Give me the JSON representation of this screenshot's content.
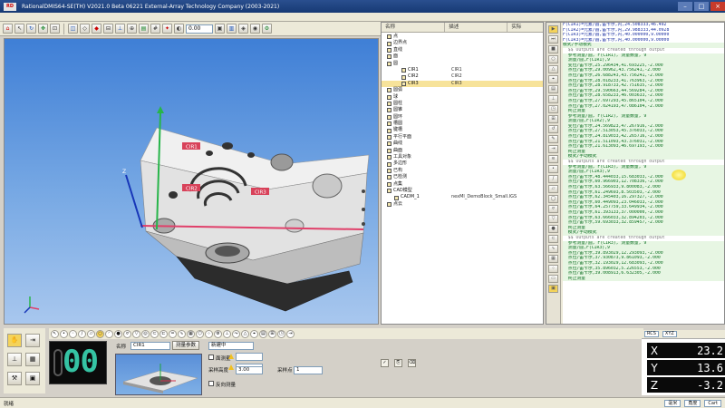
{
  "window": {
    "title": "RationalDMIS64-SE(TH) V2021.0 Beta 06221    External-Array Technology Company (2003-2021)",
    "app_badge": "RD",
    "minimize": "–",
    "maximize": "□",
    "close": "×"
  },
  "toolbar": {
    "zoom_value": "0.00"
  },
  "viewport": {
    "feature_labels": [
      "CIR1",
      "CIR2",
      "CIR3"
    ],
    "axis_label_z": "Z",
    "colors": {
      "sky_top": "#3f7fd6",
      "part": "#e4e4e4",
      "label_bg": "#d8425a",
      "axis_x": "#e0406a",
      "axis_y": "#27b54a",
      "axis_z": "#1736b8"
    }
  },
  "tree": {
    "columns": [
      "名称",
      "描述",
      "实际"
    ],
    "rows": [
      {
        "name": "点",
        "value": ""
      },
      {
        "name": "边界点",
        "value": ""
      },
      {
        "name": "直线",
        "value": ""
      },
      {
        "name": "面",
        "value": ""
      },
      {
        "name": "圆",
        "value": ""
      },
      {
        "name": "CIR1",
        "value": "CIR1",
        "indent": 2
      },
      {
        "name": "CIR2",
        "value": "CIR2",
        "indent": 2
      },
      {
        "name": "CIR3",
        "value": "CIR3",
        "indent": 2,
        "selected": true
      },
      {
        "name": "圆弧",
        "value": ""
      },
      {
        "name": "球",
        "value": ""
      },
      {
        "name": "圆柱",
        "value": ""
      },
      {
        "name": "圆锥",
        "value": ""
      },
      {
        "name": "圆环",
        "value": ""
      },
      {
        "name": "槽圆",
        "value": ""
      },
      {
        "name": "键槽",
        "value": ""
      },
      {
        "name": "平行平面",
        "value": ""
      },
      {
        "name": "曲线",
        "value": ""
      },
      {
        "name": "曲面",
        "value": ""
      },
      {
        "name": "工具对象",
        "value": ""
      },
      {
        "name": "多边形",
        "value": ""
      },
      {
        "name": "已构",
        "value": ""
      },
      {
        "name": "已检测",
        "value": ""
      },
      {
        "name": "点集",
        "value": ""
      },
      {
        "name": "CAD模型",
        "value": ""
      },
      {
        "name": "CADM_1",
        "value": "nexMl_DemoBlock_Small.IGS",
        "indent": 1
      },
      {
        "name": "点云",
        "value": ""
      }
    ]
  },
  "editor": {
    "lines": [
      {
        "t": "F(CIR1)=元素/圆,笛卡尔,内,24.508333,46.492",
        "c": "blue"
      },
      {
        "t": "F(CIR2)=元素/圆,笛卡尔,内,29.988333,44.0928",
        "c": "blue"
      },
      {
        "t": "F(CIR3)=元素/圆,笛卡尔,内,40.000000,9.00000",
        "c": "blue"
      },
      {
        "t": "F(CIR3)=元素/圆,笛卡尔,内,40.000000,9.00000",
        "c": "blue"
      },
      {
        "t": "模式/手动模式",
        "c": "green"
      },
      {
        "t": "  $$ Outputs are created through output",
        "c": "grey"
      },
      {
        "t": "  参考测量/圆, F(CIR1), 测量数量, 9",
        "c": "green"
      },
      {
        "t": "  测量/圆,F(CIR1),9",
        "c": "green"
      },
      {
        "t": "  变位/笛卡尔,25.296434,41.693225,-2.000",
        "c": "green"
      },
      {
        "t": "  点位/笛卡尔,29.00962,43.756241,-2.000",
        "c": "green"
      },
      {
        "t": "  点位/笛卡尔,26.688243,43.756241,-2.000",
        "c": "green"
      },
      {
        "t": "  点位/笛卡尔,28.018233,41.763963,-2.000",
        "c": "green"
      },
      {
        "t": "  点位/笛卡尔,28.918733,42.751635,-2.000",
        "c": "green"
      },
      {
        "t": "  点位/笛卡尔,29.590663,44.569284,-2.000",
        "c": "green"
      },
      {
        "t": "  点位/笛卡尔,28.658233,46.003633,-2.000",
        "c": "green"
      },
      {
        "t": "  点位/笛卡尔,27.697293,45.865104,-2.000",
        "c": "green"
      },
      {
        "t": "  点位/笛卡尔,27.024193,47.086104,-2.000",
        "c": "green"
      },
      {
        "t": "  终止测量",
        "c": "green"
      },
      {
        "t": "  参考测量/圆, F(CIR2), 测量数量, 9",
        "c": "green"
      },
      {
        "t": "  测量/圆,F(CIR2),9",
        "c": "green"
      },
      {
        "t": "  变位/笛卡尔,24.569823,47.267916,-2.000",
        "c": "green"
      },
      {
        "t": "  点位/笛卡尔,27.513053,45.376033,-2.000",
        "c": "green"
      },
      {
        "t": "  点位/笛卡尔,24.819033,42.265716,-2.000",
        "c": "green"
      },
      {
        "t": "  点位/笛卡尔,21.511093,43.376031,-2.000",
        "c": "green"
      },
      {
        "t": "  点位/笛卡尔,21.613093,46.697193,-2.000",
        "c": "green"
      },
      {
        "t": "  终止测量",
        "c": "green"
      },
      {
        "t": "  模式/手动模式",
        "c": "green"
      },
      {
        "t": "  $$ Outputs are created through output",
        "c": "grey"
      },
      {
        "t": "  参考测量/圆, F(CIR3), 测量数量, 9",
        "c": "green"
      },
      {
        "t": "  测量/圆,F(CIR3),9",
        "c": "green"
      },
      {
        "t": "  点位/笛卡尔,48.444033,15.683033,-2.000",
        "c": "green"
      },
      {
        "t": "  点位/笛卡尔,60.966903,12.708336,-2.000",
        "c": "green"
      },
      {
        "t": "  点位/笛卡尔,63.566933,9.800083,-2.000",
        "c": "green"
      },
      {
        "t": "  点位/笛卡尔,61.249693,8.503503,-2.000",
        "c": "green"
      },
      {
        "t": "  点位/笛卡尔,62.345403,16.297327,-2.000",
        "c": "green"
      },
      {
        "t": "  点位/笛卡尔,60.449093,23.046033,-2.000",
        "c": "green"
      },
      {
        "t": "  点位/笛卡尔,64.257759,33.649934,-2.000",
        "c": "green"
      },
      {
        "t": "  点位/笛卡尔,61.393133,37.000000,-2.000",
        "c": "green"
      },
      {
        "t": "  点位/笛卡尔,63.666033,32.894203,-2.000",
        "c": "green"
      },
      {
        "t": "  点位/笛卡尔,59.693033,32.859457,-2.000",
        "c": "green"
      },
      {
        "t": "  终止测量",
        "c": "green"
      },
      {
        "t": "  模式/手动模式",
        "c": "green"
      },
      {
        "t": "  $$ Outputs are created through output",
        "c": "grey"
      },
      {
        "t": "  参考测量/圆, F(CIR3), 测量数量, 9",
        "c": "green"
      },
      {
        "t": "  测量/圆,F(CIR3),9",
        "c": "green"
      },
      {
        "t": "  点位/笛卡尔,39.893029,12.293093,-2.000",
        "c": "green"
      },
      {
        "t": "  点位/笛卡尔,37.930873,9.861093,-2.000",
        "c": "green"
      },
      {
        "t": "  点位/笛卡尔,32.193029,12.683093,-2.000",
        "c": "green"
      },
      {
        "t": "  点位/笛卡尔,35.896032,5.226553,-2.000",
        "c": "green"
      },
      {
        "t": "  点位/笛卡尔,39.008913,6.632305,-2.000",
        "c": "green"
      },
      {
        "t": "  终止测量",
        "c": "green"
      }
    ]
  },
  "counter": {
    "value": "00"
  },
  "form": {
    "name_label": "名称",
    "name_value": "CIR1",
    "advanced_button": "测量参数",
    "select_value": "新建中",
    "sample_label": "面测量",
    "pitch_label": "采样高度",
    "pitch_value": "3.00",
    "points_label": "采样点",
    "points_value": "1",
    "reverse_label": "反向测量"
  },
  "dro": {
    "selector_left": "RCS",
    "selector_right": "XYZ",
    "rows": [
      {
        "axis": "X",
        "value": "23.2"
      },
      {
        "axis": "Y",
        "value": "13.6"
      },
      {
        "axis": "Z",
        "value": "-3.2"
      }
    ]
  },
  "status": {
    "text": "就绪",
    "unit_mm": "毫米",
    "unit_deg": "角度",
    "cart": "Cart"
  }
}
